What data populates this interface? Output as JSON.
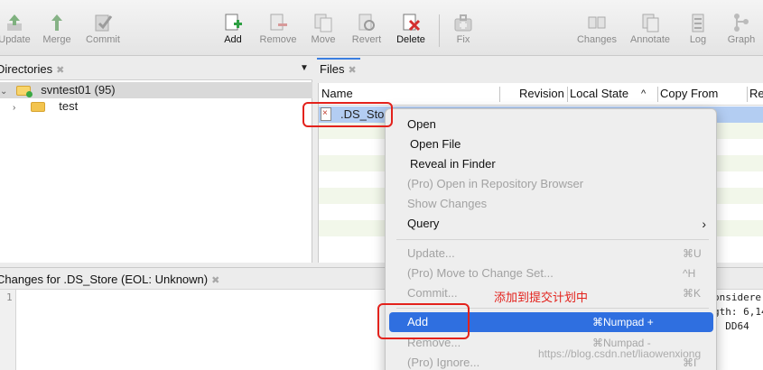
{
  "toolbar": {
    "items": [
      {
        "label": "Update",
        "icon": "update-icon"
      },
      {
        "label": "Merge",
        "icon": "merge-icon"
      },
      {
        "label": "Commit",
        "icon": "commit-icon"
      },
      {
        "label": "Add",
        "icon": "add-file-icon"
      },
      {
        "label": "Remove",
        "icon": "remove-file-icon"
      },
      {
        "label": "Move",
        "icon": "move-icon"
      },
      {
        "label": "Revert",
        "icon": "revert-icon"
      },
      {
        "label": "Delete",
        "icon": "delete-file-icon"
      },
      {
        "label": "Fix",
        "icon": "fix-icon"
      },
      {
        "label": "Changes",
        "icon": "changes-icon"
      },
      {
        "label": "Annotate",
        "icon": "annotate-icon"
      },
      {
        "label": "Log",
        "icon": "log-icon"
      },
      {
        "label": "Graph",
        "icon": "graph-icon"
      }
    ]
  },
  "directories": {
    "title": "Directories",
    "tree": [
      {
        "label": "svntest01 (95)",
        "expanded": true,
        "selected": true
      },
      {
        "label": "test",
        "expanded": false,
        "selected": false
      }
    ]
  },
  "files": {
    "tab_label": "Files",
    "columns": [
      "Name",
      "Revision",
      "Local State",
      "Copy From",
      "Re"
    ],
    "sort_indicator": "^",
    "rows": [
      {
        "name": ".DS_Sto",
        "selected": true
      }
    ]
  },
  "changes": {
    "title": "Changes for .DS_Store (EOL: Unknown)",
    "line_number": "1",
    "right_lines": [
      "onsidere",
      "gth: 6,14",
      ": DD64"
    ]
  },
  "context_menu": {
    "items": [
      {
        "label": "Open",
        "shortcut": "",
        "enabled": true
      },
      {
        "label": "Open File",
        "shortcut": "",
        "enabled": true
      },
      {
        "label": "Reveal in Finder",
        "shortcut": "",
        "enabled": true
      },
      {
        "label": "(Pro) Open in Repository Browser",
        "shortcut": "",
        "enabled": false
      },
      {
        "label": "Show Changes",
        "shortcut": "",
        "enabled": false
      },
      {
        "label": "Query",
        "shortcut": "",
        "enabled": true,
        "submenu": true
      },
      {
        "label": "Update...",
        "shortcut": "⌘U",
        "enabled": false
      },
      {
        "label": "(Pro) Move to Change Set...",
        "shortcut": "^H",
        "enabled": false
      },
      {
        "label": "Commit...",
        "shortcut": "⌘K",
        "enabled": false
      },
      {
        "label": "Add",
        "shortcut": "⌘Numpad +",
        "enabled": true,
        "highlighted": true
      },
      {
        "label": "Remove...",
        "shortcut": "⌘Numpad -",
        "enabled": false
      },
      {
        "label": "(Pro) Ignore...",
        "shortcut": "⌘I",
        "enabled": false
      }
    ],
    "submenu_chevron": "›"
  },
  "annotation": {
    "text": "添加到提交计划中",
    "color": "#e3221c"
  },
  "watermark": "https://blog.csdn.net/liaowenxiong",
  "colors": {
    "highlight": "#2f6fe0",
    "selection": "#b3cdf2",
    "annotation_red": "#e3221c"
  }
}
